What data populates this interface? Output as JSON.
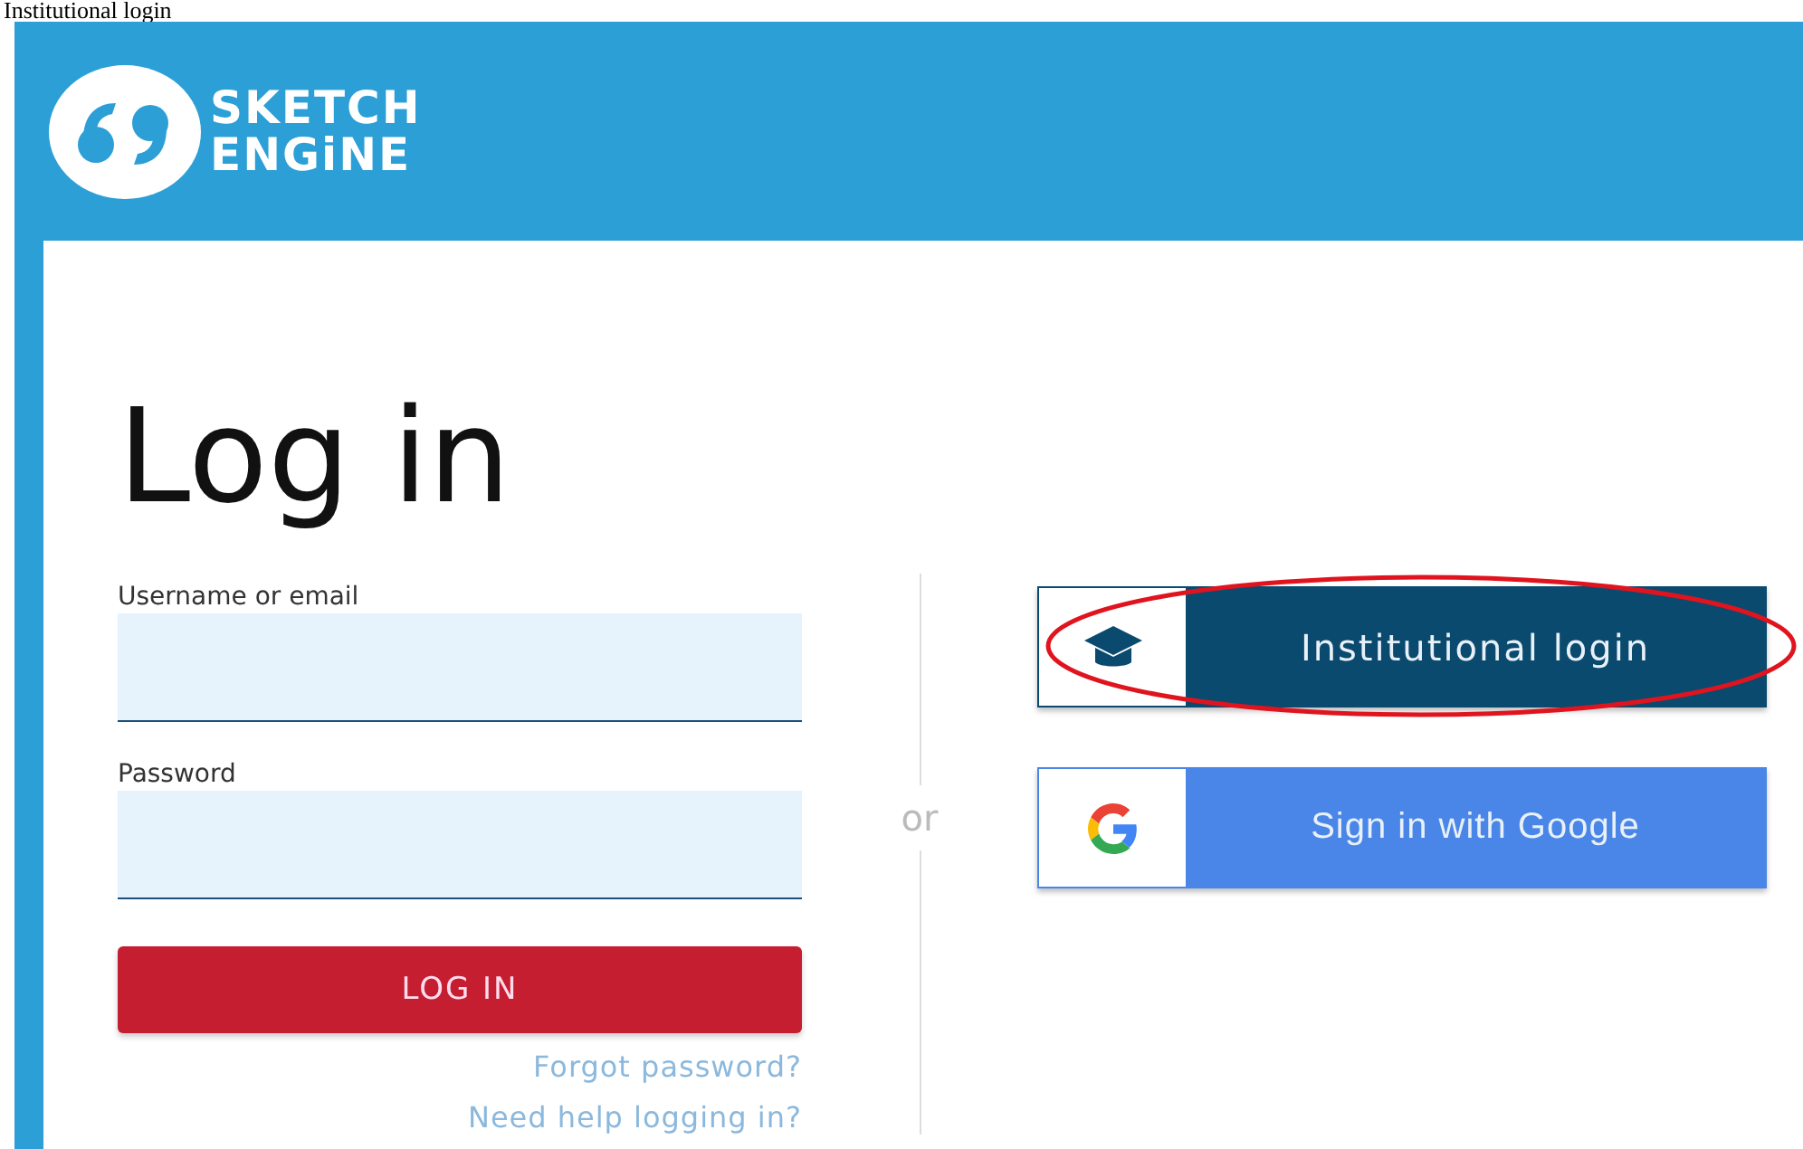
{
  "caption": "Institutional login",
  "logo": {
    "line_1": "SKETCH",
    "line_2": "ENGiNE"
  },
  "heading": "Log in",
  "fields": [
    {
      "label": "Username or email"
    },
    {
      "label": "Password"
    }
  ],
  "submit": "LOG IN",
  "links": [
    "Forgot password?",
    "Need help logging in?"
  ],
  "separator": "or",
  "providers": [
    {
      "label": "Institutional login",
      "kind": "institution",
      "circled": true
    },
    {
      "label": "Sign in with Google",
      "kind": "google",
      "circled": false
    }
  ]
}
